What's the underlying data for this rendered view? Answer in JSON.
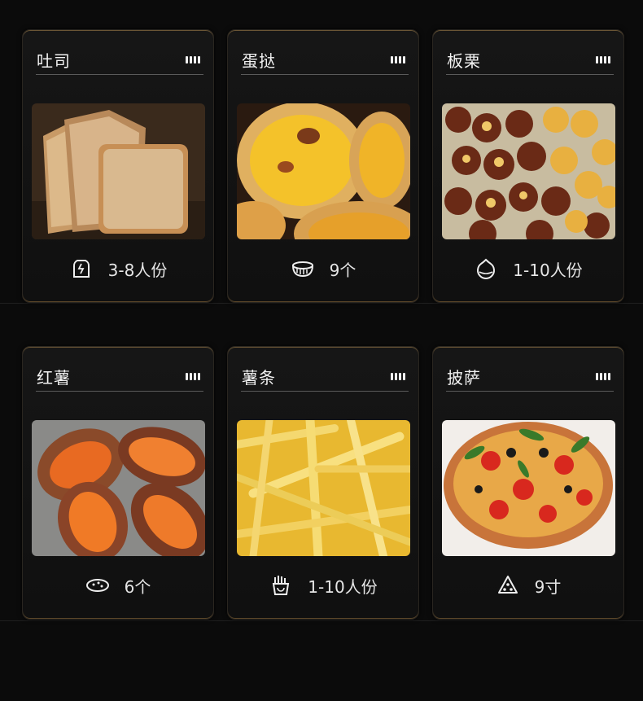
{
  "cards": [
    {
      "title": "吐司",
      "info": "3-8人份",
      "icon": "toast-icon"
    },
    {
      "title": "蛋挞",
      "info": "9个",
      "icon": "bowl-icon"
    },
    {
      "title": "板栗",
      "info": "1-10人份",
      "icon": "chestnut-icon"
    },
    {
      "title": "红薯",
      "info": "6个",
      "icon": "sweet-potato-icon"
    },
    {
      "title": "薯条",
      "info": "1-10人份",
      "icon": "fries-icon"
    },
    {
      "title": "披萨",
      "info": "9寸",
      "icon": "pizza-slice-icon"
    }
  ],
  "colors": {
    "background": "#0b0b0b",
    "card": "#141414",
    "border_gold": "#6a5535",
    "text": "#f2f2f2"
  }
}
